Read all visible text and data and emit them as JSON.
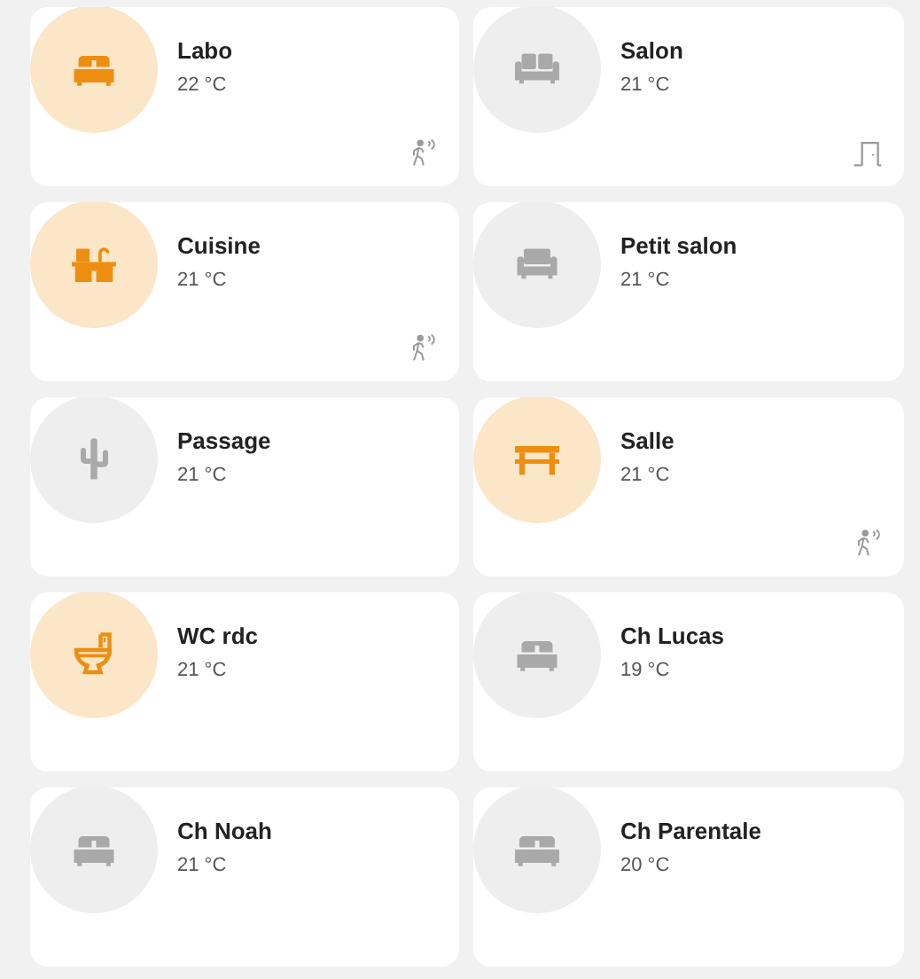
{
  "rooms": [
    {
      "name": "Labo",
      "temperature": "22 °C",
      "active": true,
      "kind": "bed",
      "sensors": [
        {
          "kind": "motion"
        }
      ]
    },
    {
      "name": "Salon",
      "temperature": "21 °C",
      "active": false,
      "kind": "sofa",
      "sensors": [
        {
          "kind": "door"
        }
      ]
    },
    {
      "name": "Cuisine",
      "temperature": "21 °C",
      "active": true,
      "kind": "kitchen",
      "sensors": [
        {
          "kind": "motion"
        }
      ]
    },
    {
      "name": "Petit salon",
      "temperature": "21 °C",
      "active": false,
      "kind": "armchair"
    },
    {
      "name": "Passage",
      "temperature": "21 °C",
      "active": false,
      "kind": "cactus"
    },
    {
      "name": "Salle",
      "temperature": "21 °C",
      "active": true,
      "kind": "table",
      "sensors": [
        {
          "kind": "motion"
        }
      ]
    },
    {
      "name": "WC rdc",
      "temperature": "21 °C",
      "active": true,
      "kind": "toilet"
    },
    {
      "name": "Ch Lucas",
      "temperature": "19 °C",
      "active": false,
      "kind": "bed"
    },
    {
      "name": "Ch Noah",
      "temperature": "21 °C",
      "active": false,
      "kind": "bed"
    },
    {
      "name": "Ch Parentale",
      "temperature": "20 °C",
      "active": false,
      "kind": "wide"
    }
  ]
}
